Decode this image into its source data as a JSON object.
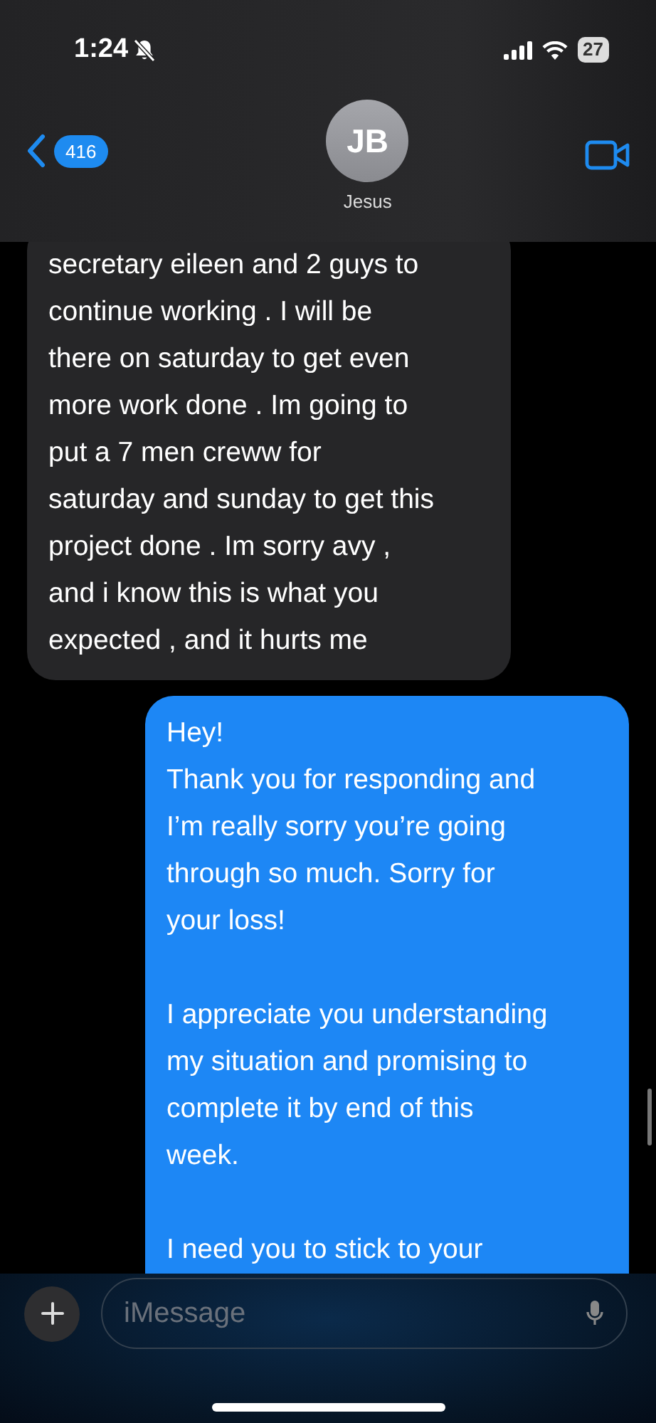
{
  "status_bar": {
    "time": "1:24",
    "silent": true,
    "battery": "27"
  },
  "header": {
    "back_count": "416",
    "avatar_initials": "JB",
    "contact_name": "Jesus"
  },
  "messages": [
    {
      "kind": "incoming",
      "text": "secretary eileen and 2 guys to\ncontinue working . I will be\nthere on saturday to get even\nmore work done . Im going to\nput a 7 men creww for\nsaturday and sunday to get this\nproject done . Im sorry avy ,\nand i know this is what you\nexpected , and it hurts me"
    },
    {
      "kind": "outgoing",
      "text": "Hey!\nThank you for responding and\nI’m really sorry you’re going\nthrough so much. Sorry for\nyour loss!\n\nI appreciate you understanding\nmy situation and promising to\ncomplete it by end of this\nweek.\n\nI need you to stick to your"
    }
  ],
  "composer": {
    "placeholder": "iMessage"
  }
}
